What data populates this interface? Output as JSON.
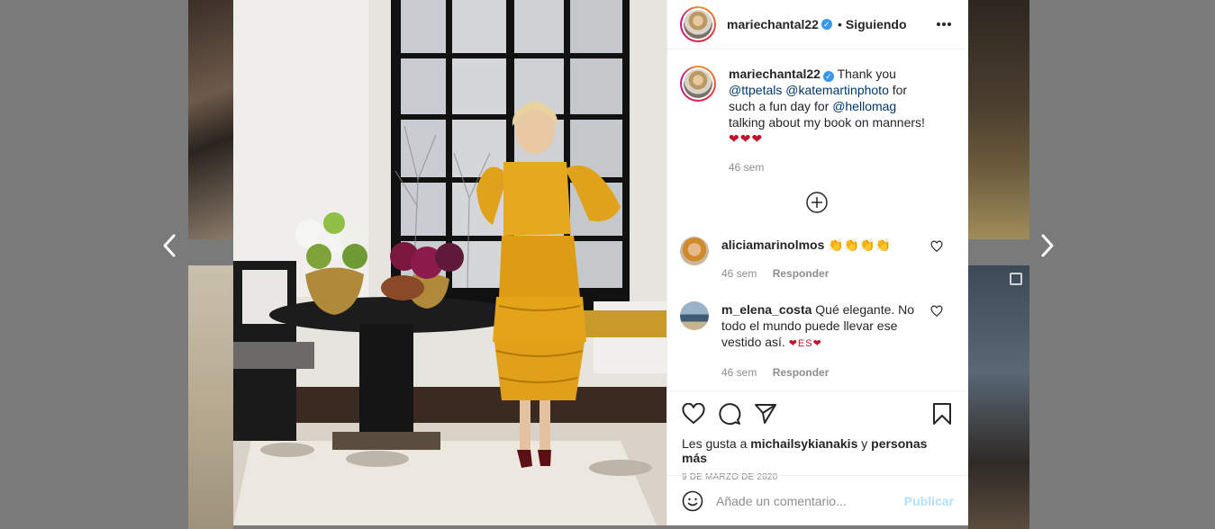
{
  "header": {
    "username": "mariechantal22",
    "separator": "•",
    "follow_status": "Siguiendo",
    "verified_icon": "verified-badge-icon",
    "more_icon": "more-options-icon"
  },
  "caption": {
    "username": "mariechantal22",
    "text_1": "Thank you",
    "mention_1": "@ttpetals",
    "mention_2": "@katemartinphoto",
    "text_2": "for such a fun day for",
    "mention_3": "@hellomag",
    "text_3": "talking about my book on manners!",
    "emoji": "❤❤❤",
    "time": "46 sem"
  },
  "comments": [
    {
      "username": "aliciamarinolmos",
      "text": "",
      "emoji": "👏👏👏👏",
      "time": "46 sem",
      "reply_label": "Responder"
    },
    {
      "username": "m_elena_costa",
      "text": "Qué elegante. No todo el mundo puede llevar ese vestido así.",
      "emoji": "❤ES❤",
      "time": "46 sem",
      "reply_label": "Responder"
    }
  ],
  "actions": {
    "likes_prefix": "Les gusta a",
    "likes_user": "michailsykianakis",
    "likes_joiner": "y",
    "likes_others": "personas más",
    "date": "9 DE MARZO DE 2020"
  },
  "add_comment": {
    "placeholder": "Añade un comentario...",
    "publish_label": "Publicar"
  },
  "colors": {
    "link": "#00376b",
    "verified": "#3897f0",
    "publish_disabled": "#b2dffc",
    "muted": "#8e8e8e",
    "dress": "#e0a21a"
  }
}
